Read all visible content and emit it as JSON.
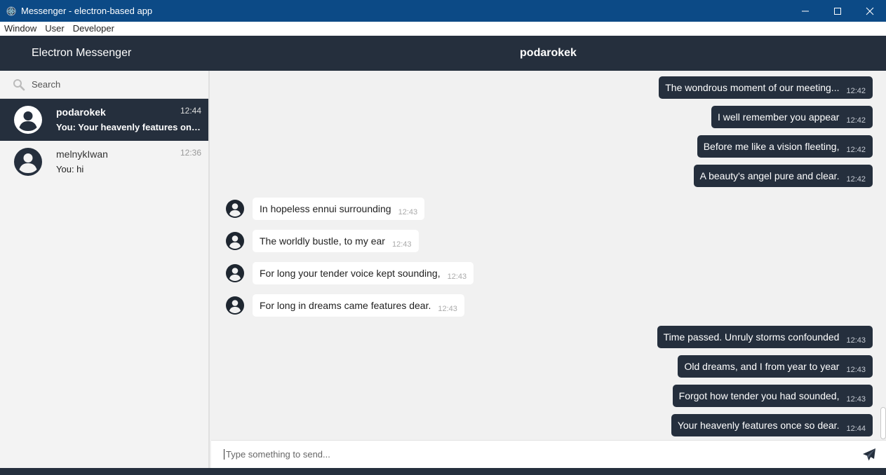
{
  "window": {
    "title": "Messenger - electron-based app"
  },
  "menu": [
    "Window",
    "User",
    "Developer"
  ],
  "header": {
    "brand": "Electron Messenger",
    "chat_title": "podarokek"
  },
  "search": {
    "placeholder": "Search"
  },
  "conversations": [
    {
      "name": "podarokek",
      "preview": "You: Your heavenly features once so dear.",
      "time": "12:44",
      "active": true
    },
    {
      "name": "melnykIwan",
      "preview": "You: hi",
      "time": "12:36",
      "active": false
    }
  ],
  "messages": [
    {
      "direction": "out",
      "text": "The wondrous moment of our meeting...",
      "time": "12:42"
    },
    {
      "direction": "out",
      "text": "I well remember you appear",
      "time": "12:42"
    },
    {
      "direction": "out",
      "text": "Before me like a vision fleeting,",
      "time": "12:42"
    },
    {
      "direction": "out",
      "text": "A beauty's angel pure and clear.",
      "time": "12:42"
    },
    {
      "direction": "in",
      "text": "In hopeless ennui surrounding",
      "time": "12:43"
    },
    {
      "direction": "in",
      "text": "The worldly bustle, to my ear",
      "time": "12:43"
    },
    {
      "direction": "in",
      "text": "For long your tender voice kept sounding,",
      "time": "12:43"
    },
    {
      "direction": "in",
      "text": "For long in dreams came features dear.",
      "time": "12:43"
    },
    {
      "direction": "out",
      "text": "Time passed. Unruly storms confounded",
      "time": "12:43"
    },
    {
      "direction": "out",
      "text": "Old dreams, and I from year to year",
      "time": "12:43"
    },
    {
      "direction": "out",
      "text": "Forgot how tender you had sounded,",
      "time": "12:43"
    },
    {
      "direction": "out",
      "text": "Your heavenly features once so dear.",
      "time": "12:44"
    }
  ],
  "composer": {
    "placeholder": "Type something to send..."
  },
  "colors": {
    "titlebar": "#0c4a86",
    "header": "#252f3d",
    "outgoing_bubble": "#252f3d",
    "incoming_bubble": "#ffffff",
    "background": "#f1f1f1"
  }
}
